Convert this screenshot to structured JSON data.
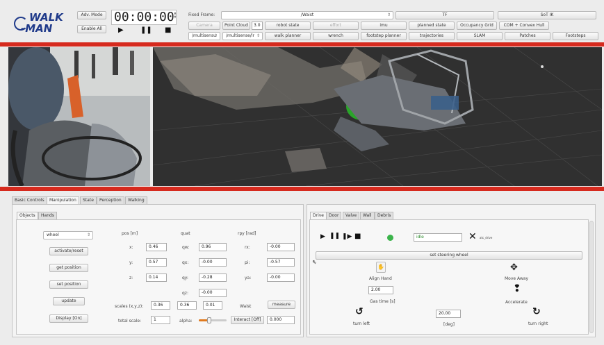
{
  "logo": {
    "line1": "WALK",
    "line2": "-MAN"
  },
  "toolbar": {
    "adv_mode": "Adv. Mode",
    "enable_all": "Enable All",
    "timer": "00:00:00",
    "fixed_frame_label": "Fixed Frame:",
    "fixed_frame_value": "/Waist",
    "tf": "TF",
    "sot_ik": "SoT IK",
    "camera": "Camera",
    "point_cloud": "Point Cloud",
    "point_cloud_value": "3.0",
    "robot_state": "robot state",
    "effort": "effort",
    "imu": "imu",
    "planned_state": "planned state",
    "occupancy_grid": "Occupancy Grid",
    "com_hull": "COM + Convex Hull",
    "multisense1": "/multisensu",
    "multisense2": "/multisense/lr",
    "walk_planner": "walk planner",
    "wrench": "wrench",
    "footstep_planner": "footstep planner",
    "trajectories": "trajectories",
    "slam": "SLAM",
    "patches": "Patches",
    "footsteps": "Footsteps"
  },
  "main_tabs": [
    "Basic Controls",
    "Manipulation",
    "State",
    "Perception",
    "Walking"
  ],
  "sub_tabs": [
    "Objects",
    "Hands"
  ],
  "objects": {
    "selector": "wheel",
    "buttons": [
      "activate/reset",
      "get position",
      "set position",
      "update",
      "Display [On]"
    ],
    "headers": {
      "pos": "pos [m]",
      "quat": "quat",
      "rpy": "rpy [rad]"
    },
    "pos": [
      {
        "label": "x:",
        "value": "0.46"
      },
      {
        "label": "y:",
        "value": "0.57"
      },
      {
        "label": "z:",
        "value": "0.14"
      }
    ],
    "quat": [
      {
        "label": "qw:",
        "value": "0.96"
      },
      {
        "label": "qx:",
        "value": "-0.00"
      },
      {
        "label": "qy:",
        "value": "-0.28"
      },
      {
        "label": "qz:",
        "value": "-0.00"
      }
    ],
    "rpy": [
      {
        "label": "rx:",
        "value": "-0.00"
      },
      {
        "label": "pi:",
        "value": "-0.57"
      },
      {
        "label": "ya:",
        "value": "-0.00"
      }
    ],
    "scales_label": "scales (x,y,z):",
    "scales": [
      "0.36",
      "0.36",
      "0.01"
    ],
    "frame": "Waist",
    "measure": "measure",
    "total_scale_label": "total scale:",
    "total_scale": "1",
    "alpha_label": "alpha:",
    "interact": "Interact [Off]",
    "interact_value": "0.000"
  },
  "right_tabs": [
    "Drive",
    "Door",
    "Valve",
    "Wall",
    "Debris"
  ],
  "drive": {
    "status": "idle",
    "status_color": "#3cb44b",
    "close_label": "atc_drive",
    "set_steering": "set steering wheel",
    "align_hand": "Align Hand",
    "move_away": "Move Away",
    "gas_time_value": "2.00",
    "gas_time_label": "Gas time [s]",
    "accelerate": "Accelerate",
    "deg_value": "20.00",
    "deg_label": "[deg]",
    "turn_left": "turn left",
    "turn_right": "turn right"
  }
}
